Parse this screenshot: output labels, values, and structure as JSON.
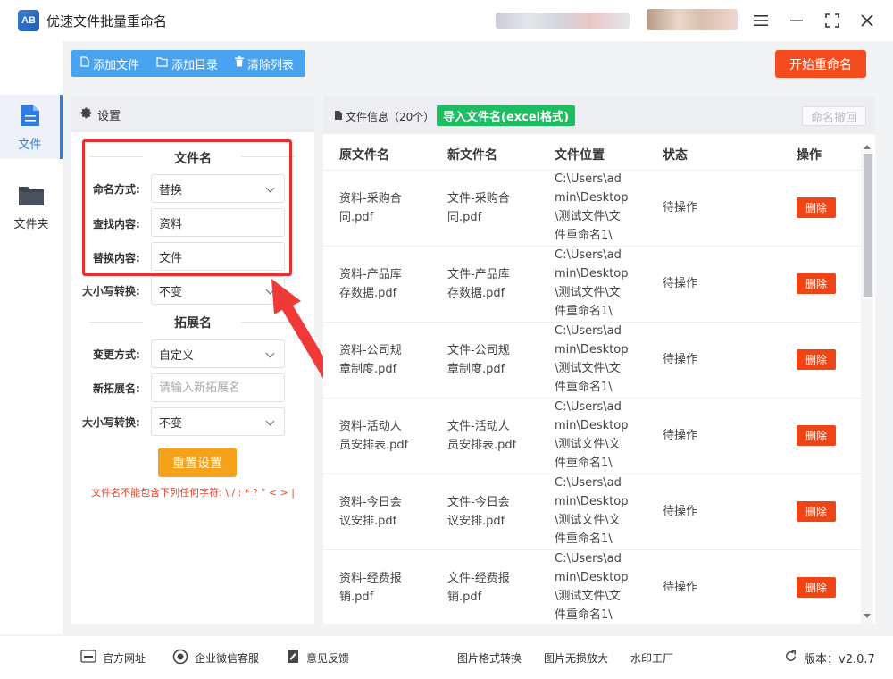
{
  "app": {
    "title": "优速文件批量重命名",
    "logo_text": "AB"
  },
  "nav": {
    "items": [
      {
        "label": "文件",
        "icon": "file-icon",
        "active": true
      },
      {
        "label": "文件夹",
        "icon": "folder-icon",
        "active": false
      }
    ]
  },
  "toolbar": {
    "add_file": "添加文件",
    "add_dir": "添加目录",
    "clear_list": "清除列表",
    "start": "开始重命名"
  },
  "settings": {
    "header": "设置",
    "filename_section": "文件名",
    "naming_mode_label": "命名方式:",
    "naming_mode_value": "替换",
    "find_label": "查找内容:",
    "find_value": "资料",
    "replace_label": "替换内容:",
    "replace_value": "文件",
    "case_label": "大小写转换:",
    "case_value": "不变",
    "ext_section": "拓展名",
    "change_mode_label": "变更方式:",
    "change_mode_value": "自定义",
    "new_ext_label": "新拓展名:",
    "new_ext_placeholder": "请输入新拓展名",
    "ext_case_label": "大小写转换:",
    "ext_case_value": "不变",
    "reset": "重置设置",
    "warning": "文件名不能包含下列任何字符: \\ / : * ? \" < > |"
  },
  "files": {
    "header": "文件信息（20个）",
    "import_excel": "导入文件名(excel格式)",
    "undo": "命名撤回",
    "columns": [
      "原文件名",
      "新文件名",
      "文件位置",
      "状态",
      "操作"
    ],
    "rows": [
      {
        "orig": [
          "资料-采购合",
          "同.pdf"
        ],
        "new": [
          "文件-采购合",
          "同.pdf"
        ],
        "path": [
          "C:\\Users\\ad",
          "min\\Desktop",
          "\\测试文件\\文",
          "件重命名1\\"
        ],
        "status": "待操作",
        "action": "删除"
      },
      {
        "orig": [
          "资料-产品库",
          "存数据.pdf"
        ],
        "new": [
          "文件-产品库",
          "存数据.pdf"
        ],
        "path": [
          "C:\\Users\\ad",
          "min\\Desktop",
          "\\测试文件\\文",
          "件重命名1\\"
        ],
        "status": "待操作",
        "action": "删除"
      },
      {
        "orig": [
          "资料-公司规",
          "章制度.pdf"
        ],
        "new": [
          "文件-公司规",
          "章制度.pdf"
        ],
        "path": [
          "C:\\Users\\ad",
          "min\\Desktop",
          "\\测试文件\\文",
          "件重命名1\\"
        ],
        "status": "待操作",
        "action": "删除"
      },
      {
        "orig": [
          "资料-活动人",
          "员安排表.pdf"
        ],
        "new": [
          "文件-活动人",
          "员安排表.pdf"
        ],
        "path": [
          "C:\\Users\\ad",
          "min\\Desktop",
          "\\测试文件\\文",
          "件重命名1\\"
        ],
        "status": "待操作",
        "action": "删除"
      },
      {
        "orig": [
          "资料-今日会",
          "议安排.pdf"
        ],
        "new": [
          "文件-今日会",
          "议安排.pdf"
        ],
        "path": [
          "C:\\Users\\ad",
          "min\\Desktop",
          "\\测试文件\\文",
          "件重命名1\\"
        ],
        "status": "待操作",
        "action": "删除"
      },
      {
        "orig": [
          "资料-经费报",
          "销.pdf"
        ],
        "new": [
          "文件-经费报",
          "销.pdf"
        ],
        "path": [
          "C:\\Users\\ad",
          "min\\Desktop",
          "\\测试文件\\文",
          "件重命名1\\"
        ],
        "status": "待操作",
        "action": "删除"
      }
    ]
  },
  "footer": {
    "website": "官方网址",
    "wechat": "企业微信客服",
    "feedback": "意见反馈",
    "img_convert": "图片格式转换",
    "img_enlarge": "图片无损放大",
    "watermark": "水印工厂",
    "version": "版本：v2.0.7"
  },
  "colors": {
    "accent": "#2f7de1",
    "toolbar": "#4aa3f0",
    "start_button": "#f24c1f",
    "import_button": "#1fbd61",
    "reset_button": "#f7a21b",
    "delete_button": "#ee4416",
    "highlight": "#e63030"
  }
}
